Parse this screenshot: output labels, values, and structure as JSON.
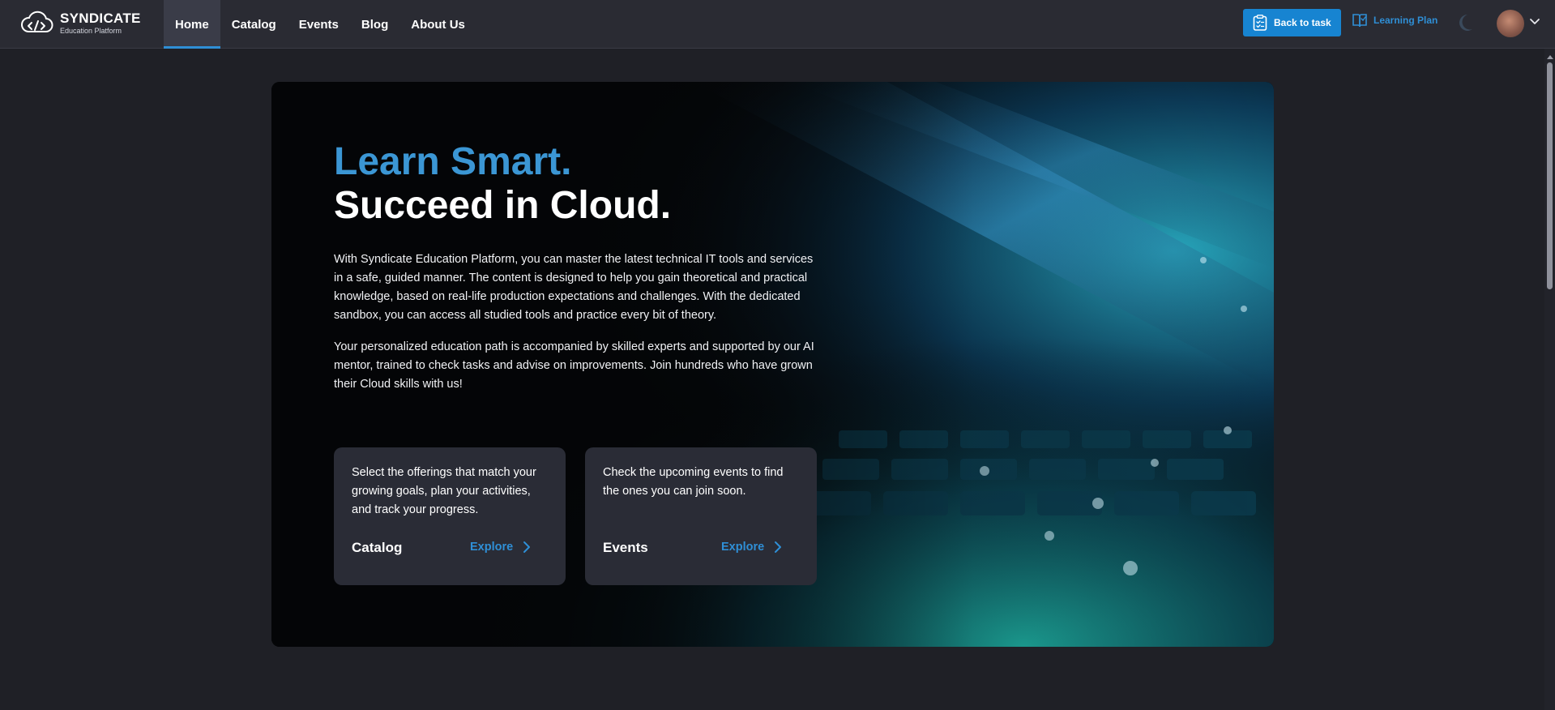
{
  "brand": {
    "name": "SYNDICATE",
    "subtitle": "Education Platform"
  },
  "nav": {
    "items": [
      {
        "label": "Home",
        "active": true
      },
      {
        "label": "Catalog",
        "active": false
      },
      {
        "label": "Events",
        "active": false
      },
      {
        "label": "Blog",
        "active": false
      },
      {
        "label": "About Us",
        "active": false
      }
    ]
  },
  "header_actions": {
    "back_to_task": "Back to task",
    "learning_plan": "Learning Plan",
    "theme_icon": "moon-icon",
    "avatar_icon": "user-avatar"
  },
  "hero": {
    "headline_line1": "Learn Smart.",
    "headline_line2": "Succeed in Cloud.",
    "paragraph1": "With Syndicate Education Platform, you can master the latest technical IT tools and services in a safe, guided manner. The content is designed to help you gain theoretical and practical knowledge, based on real-life production expectations and challenges. With the dedicated sandbox, you can access all studied tools and practice every bit of theory.",
    "paragraph2": "Your personalized education path is accompanied by skilled experts and supported by our AI mentor, trained to check tasks and advise on improvements. Join hundreds who have grown their Cloud skills with us!"
  },
  "cards": [
    {
      "description": "Select the offerings that match your growing goals, plan your activities, and track your progress.",
      "title": "Catalog",
      "link": "Explore"
    },
    {
      "description": "Check the upcoming events to find the ones you can join soon.",
      "title": "Events",
      "link": "Explore"
    }
  ],
  "colors": {
    "accent": "#2f8fd6",
    "button": "#1784d1",
    "headline_accent": "#3b96d4",
    "background": "#1f2026",
    "topbar": "#2a2b33",
    "card": "#2a2c36"
  }
}
